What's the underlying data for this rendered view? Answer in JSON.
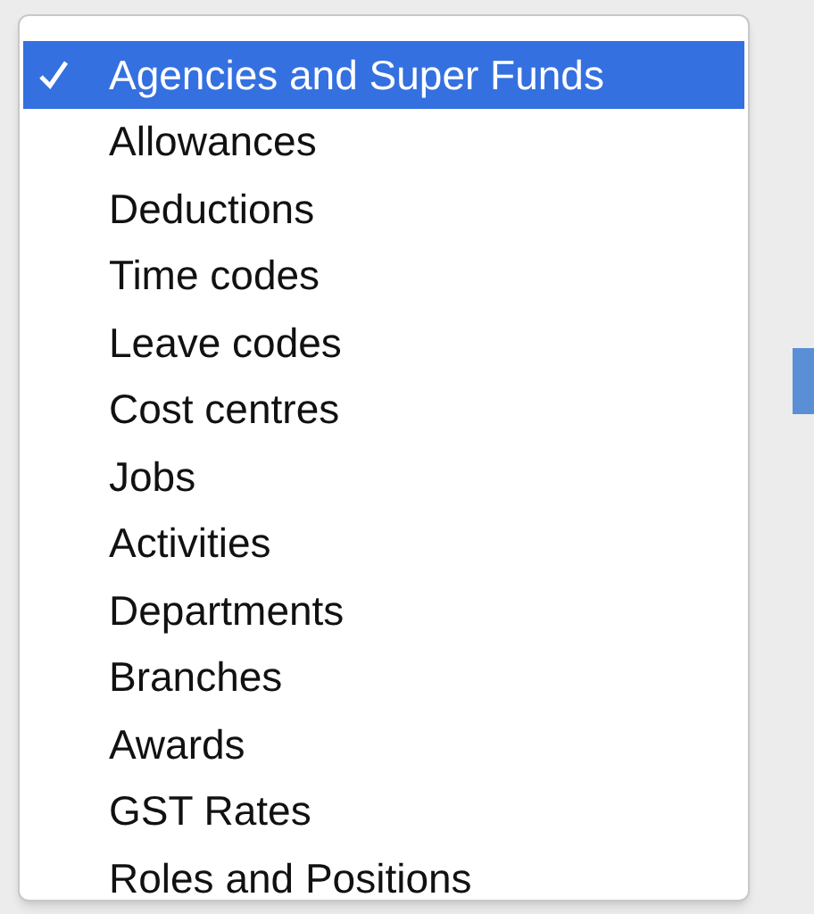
{
  "menu": {
    "items": [
      {
        "label": "Agencies and Super Funds",
        "selected": true
      },
      {
        "label": "Allowances",
        "selected": false
      },
      {
        "label": "Deductions",
        "selected": false
      },
      {
        "label": "Time codes",
        "selected": false
      },
      {
        "label": "Leave codes",
        "selected": false
      },
      {
        "label": "Cost centres",
        "selected": false
      },
      {
        "label": "Jobs",
        "selected": false
      },
      {
        "label": "Activities",
        "selected": false
      },
      {
        "label": "Departments",
        "selected": false
      },
      {
        "label": "Branches",
        "selected": false
      },
      {
        "label": "Awards",
        "selected": false
      },
      {
        "label": "GST Rates",
        "selected": false
      },
      {
        "label": "Roles and Positions",
        "selected": false
      }
    ]
  }
}
